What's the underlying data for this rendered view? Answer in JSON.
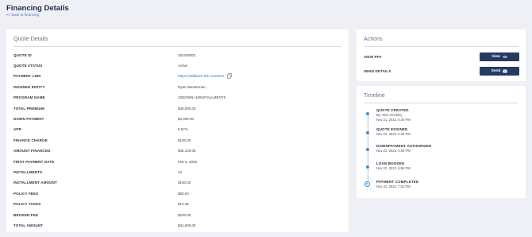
{
  "header": {
    "title": "Financing Details",
    "back_link": "<< back to financing"
  },
  "quote_details": {
    "title": "Quote Details",
    "rows": [
      {
        "label": "QUOTE ID",
        "value": "202200001"
      },
      {
        "label": "QUOTE STATUS",
        "value": "Active"
      },
      {
        "label": "PAYMENT LINK",
        "value": "https://3ddblock.link.com/test"
      },
      {
        "label": "INSURED ENTITY",
        "value": "Ryan Westerman"
      },
      {
        "label": "PROGRAM NAME",
        "value": "10DOWN+10INSTALLMENTS"
      },
      {
        "label": "TOTAL PREMIUM",
        "value": "$40,000.00"
      },
      {
        "label": "DOWN PAYMENT",
        "value": "$4,000.00"
      },
      {
        "label": "APR",
        "value": "5.67%"
      },
      {
        "label": "FINANCE CHARGE",
        "value": "$100.00"
      },
      {
        "label": "AMOUNT FINANCED",
        "value": "$35,100.00"
      },
      {
        "label": "FIRST PAYMENT DATE",
        "value": "Feb 6, 2025"
      },
      {
        "label": "INSTALLMENTS",
        "value": "10"
      },
      {
        "label": "INSTALLMENT AMOUNT",
        "value": "$150.00"
      },
      {
        "label": "POLICY FEES",
        "value": "$50.00"
      },
      {
        "label": "POLICY TAXES",
        "value": "$10.45"
      },
      {
        "label": "BROKER FEE",
        "value": "$200.00"
      },
      {
        "label": "TOTAL AMOUNT",
        "value": "$41,000.00"
      }
    ]
  },
  "actions": {
    "title": "Actions",
    "items": [
      {
        "label": "VIEW PFA",
        "button": "View",
        "icon": "eye-icon"
      },
      {
        "label": "SEND DETAILS",
        "button": "Send",
        "icon": "mail-icon"
      }
    ]
  },
  "timeline": {
    "title": "Timeline",
    "events": [
      {
        "title": "QUOTE CREATED",
        "by": "By: Nick Hinckley",
        "date": "Nov 21, 2022, 6:40 PM"
      },
      {
        "title": "QUOTE ESIGNED",
        "date": "Nov 22, 2022, 5:40 PM"
      },
      {
        "title": "DOWNPAYMENT AUTHORIZED",
        "date": "Nov 22, 2022, 6:50 PM"
      },
      {
        "title": "LOAN BOOKED",
        "date": "Nov 22, 2022, 6:55 PM"
      },
      {
        "title": "PAYMENT COMPLETED",
        "date": "Nov 22, 2022, 7:01 PM"
      }
    ]
  },
  "colors": {
    "background": "#eef0f5",
    "button": "#263a62",
    "link": "#3f73c8",
    "timeline_dot": "#3f8ed8"
  }
}
